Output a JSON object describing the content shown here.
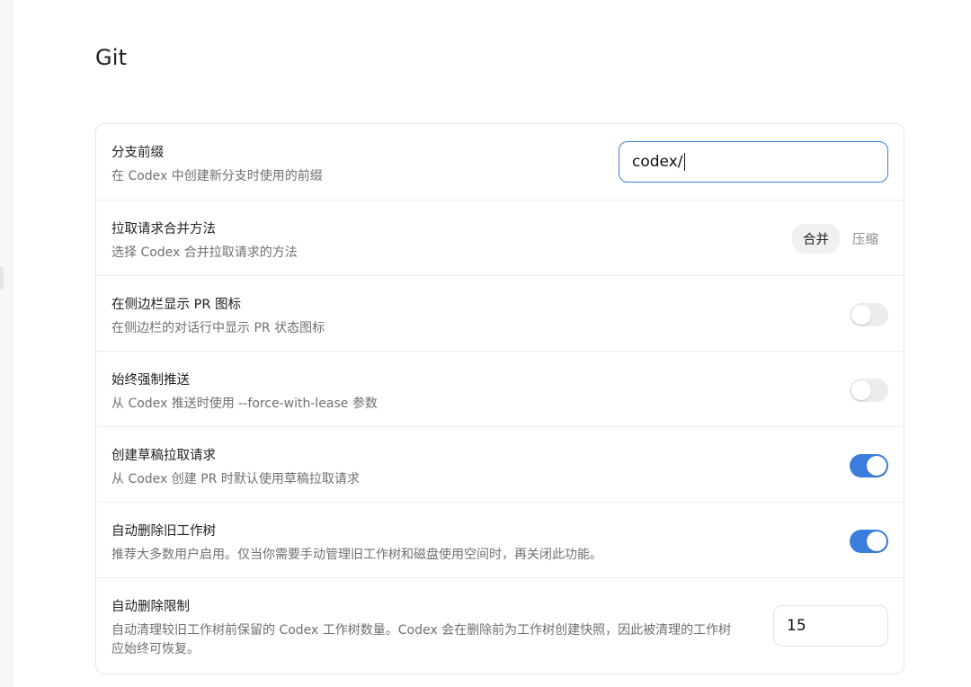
{
  "page": {
    "title": "Git"
  },
  "branch_prefix": {
    "label": "分支前缀",
    "desc": "在 Codex 中创建新分支时使用的前缀",
    "value": "codex/"
  },
  "merge_method": {
    "label": "拉取请求合并方法",
    "desc": "选择 Codex 合并拉取请求的方法",
    "options": [
      "合并",
      "压缩"
    ],
    "selected": "合并"
  },
  "sidebar_pr_icon": {
    "label": "在侧边栏显示 PR 图标",
    "desc": "在侧边栏的对话行中显示 PR 状态图标",
    "enabled": false
  },
  "force_push": {
    "label": "始终强制推送",
    "desc": "从 Codex 推送时使用 --force-with-lease 参数",
    "enabled": false
  },
  "draft_pr": {
    "label": "创建草稿拉取请求",
    "desc": "从 Codex 创建 PR 时默认使用草稿拉取请求",
    "enabled": true
  },
  "auto_delete_worktrees": {
    "label": "自动删除旧工作树",
    "desc": "推荐大多数用户启用。仅当你需要手动管理旧工作树和磁盘使用空间时，再关闭此功能。",
    "enabled": true
  },
  "auto_delete_limit": {
    "label": "自动删除限制",
    "desc": "自动清理较旧工作树前保留的 Codex 工作树数量。Codex 会在删除前为工作树创建快照，因此被清理的工作树应始终可恢复。",
    "value": "15"
  },
  "colors": {
    "accent": "#3b7ddd",
    "toggle_off": "#ececec"
  }
}
